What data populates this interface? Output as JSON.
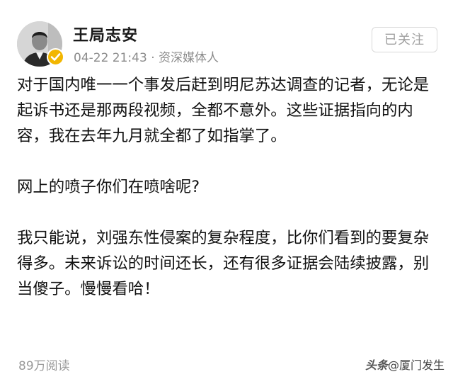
{
  "post": {
    "author": {
      "name": "王局志安",
      "verified_icon": "verified-badge-icon",
      "verified_color": "#f2b600"
    },
    "meta": "04-22 21:43 · 资深媒体人",
    "follow_button_label": "已关注",
    "paragraphs": [
      "对于国内唯一一个事发后赶到明尼苏达调查的记者，无论是起诉书还是那两段视频，全都不意外。这些证据指向的内容，我在去年九月就全都了如指掌了。",
      "网上的喷子你们在喷啥呢?",
      "我只能说，刘强东性侵案的复杂程度，比你们看到的要复杂得多。未来诉讼的时间还长，还有很多证据会陆续披露，别当傻子。慢慢看哈！"
    ],
    "read_count": "89万阅读"
  },
  "watermark": {
    "brand": "头条",
    "account": "@厦门发生"
  }
}
